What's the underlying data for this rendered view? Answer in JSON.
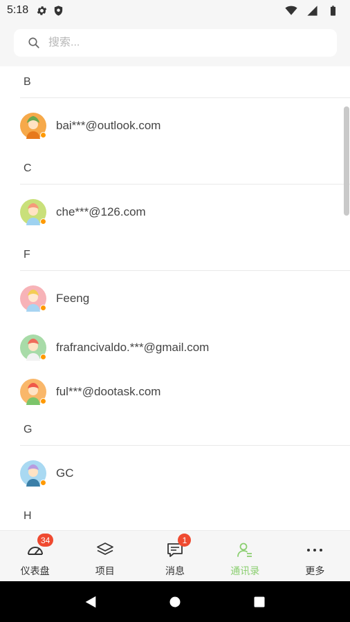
{
  "status_bar": {
    "time": "5:18",
    "icons_left": [
      "gear-icon",
      "shield-icon"
    ],
    "icons_right": [
      "wifi-icon",
      "signal-icon",
      "battery-icon"
    ]
  },
  "search": {
    "placeholder": "搜索...",
    "value": ""
  },
  "contacts": {
    "sections": [
      {
        "letter": "B",
        "items": [
          {
            "name": "bai***@outlook.com",
            "status": "away"
          }
        ]
      },
      {
        "letter": "C",
        "items": [
          {
            "name": "che***@126.com",
            "status": "away"
          }
        ]
      },
      {
        "letter": "F",
        "items": [
          {
            "name": "Feeng",
            "status": "away"
          },
          {
            "name": "frafrancivaldo.***@gmail.com",
            "status": "away"
          },
          {
            "name": "ful***@dootask.com",
            "status": "away"
          }
        ]
      },
      {
        "letter": "G",
        "items": [
          {
            "name": "GC",
            "status": "away"
          }
        ]
      },
      {
        "letter": "H",
        "items": []
      }
    ]
  },
  "tabbar": {
    "tabs": [
      {
        "label": "仪表盘",
        "icon": "dashboard-icon",
        "badge": "34",
        "active": false
      },
      {
        "label": "项目",
        "icon": "layers-icon",
        "badge": "",
        "active": false
      },
      {
        "label": "消息",
        "icon": "message-icon",
        "badge": "1",
        "active": false
      },
      {
        "label": "通讯录",
        "icon": "contacts-icon",
        "badge": "",
        "active": true
      },
      {
        "label": "更多",
        "icon": "more-icon",
        "badge": "",
        "active": false
      }
    ]
  },
  "colors": {
    "accent": "#8bcf70",
    "badge": "#ef4a30",
    "status_away": "#ff9900"
  },
  "system_nav": [
    "back-icon",
    "home-icon",
    "recents-icon"
  ]
}
